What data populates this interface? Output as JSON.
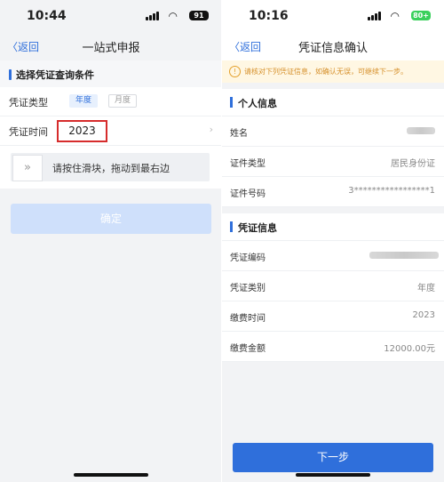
{
  "left": {
    "status": {
      "time": "10:44",
      "battery": "91"
    },
    "nav": {
      "back": "〈返回",
      "title": "一站式申报"
    },
    "section_title": "选择凭证查询条件",
    "type_label": "凭证类型",
    "type_options": [
      "年度",
      "月度"
    ],
    "time_label": "凭证时间",
    "time_value": "2023",
    "slider_hint": "请按住滑块，拖动到最右边",
    "slider_knob": "»",
    "confirm_label": "确定"
  },
  "right": {
    "status": {
      "time": "10:16",
      "battery": "80+"
    },
    "nav": {
      "back": "〈返回",
      "title": "凭证信息确认"
    },
    "notice": "请核对下列凭证信息，如确认无误，可继续下一步。",
    "personal": {
      "title": "个人信息",
      "name_label": "姓名",
      "idtype_label": "证件类型",
      "idtype_value": "居民身份证",
      "idno_label": "证件号码",
      "idno_value": "3*****************1"
    },
    "voucher": {
      "title": "凭证信息",
      "code_label": "凭证编码",
      "category_label": "凭证类别",
      "category_value": "年度",
      "paytime_label": "缴费时间",
      "paytime_value": "2023",
      "amount_label": "缴费金额",
      "amount_value": "12000.00元"
    },
    "next_label": "下一步"
  }
}
